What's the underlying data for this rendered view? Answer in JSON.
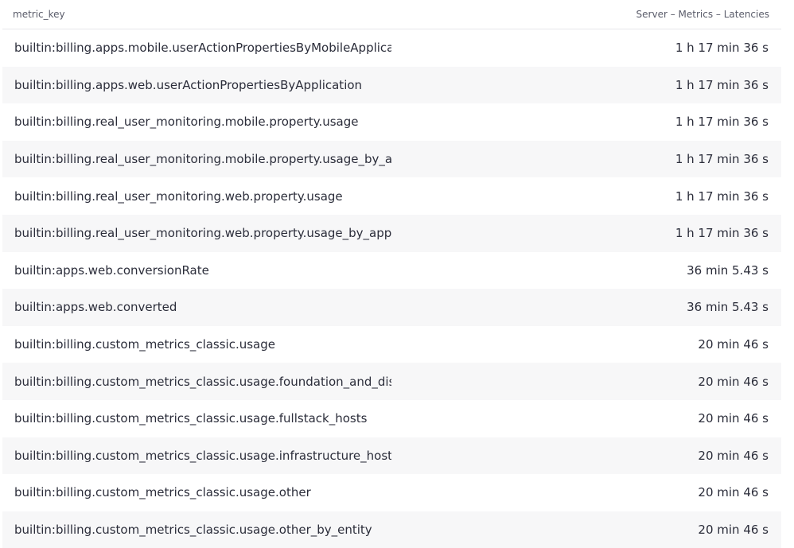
{
  "table": {
    "columns": [
      "metric_key",
      "Server – Metrics – Latencies"
    ],
    "rows": [
      {
        "metric_key": "builtin:billing.apps.mobile.userActionPropertiesByMobileApplication",
        "latency": "1 h 17 min 36 s"
      },
      {
        "metric_key": "builtin:billing.apps.web.userActionPropertiesByApplication",
        "latency": "1 h 17 min 36 s"
      },
      {
        "metric_key": "builtin:billing.real_user_monitoring.mobile.property.usage",
        "latency": "1 h 17 min 36 s"
      },
      {
        "metric_key": "builtin:billing.real_user_monitoring.mobile.property.usage_by_application",
        "latency": "1 h 17 min 36 s"
      },
      {
        "metric_key": "builtin:billing.real_user_monitoring.web.property.usage",
        "latency": "1 h 17 min 36 s"
      },
      {
        "metric_key": "builtin:billing.real_user_monitoring.web.property.usage_by_application",
        "latency": "1 h 17 min 36 s"
      },
      {
        "metric_key": "builtin:apps.web.conversionRate",
        "latency": "36 min 5.43 s"
      },
      {
        "metric_key": "builtin:apps.web.converted",
        "latency": "36 min 5.43 s"
      },
      {
        "metric_key": "builtin:billing.custom_metrics_classic.usage",
        "latency": "20 min 46 s"
      },
      {
        "metric_key": "builtin:billing.custom_metrics_classic.usage.foundation_and_discovery",
        "latency": "20 min 46 s"
      },
      {
        "metric_key": "builtin:billing.custom_metrics_classic.usage.fullstack_hosts",
        "latency": "20 min 46 s"
      },
      {
        "metric_key": "builtin:billing.custom_metrics_classic.usage.infrastructure_hosts",
        "latency": "20 min 46 s"
      },
      {
        "metric_key": "builtin:billing.custom_metrics_classic.usage.other",
        "latency": "20 min 46 s"
      },
      {
        "metric_key": "builtin:billing.custom_metrics_classic.usage.other_by_entity",
        "latency": "20 min 46 s"
      }
    ]
  }
}
